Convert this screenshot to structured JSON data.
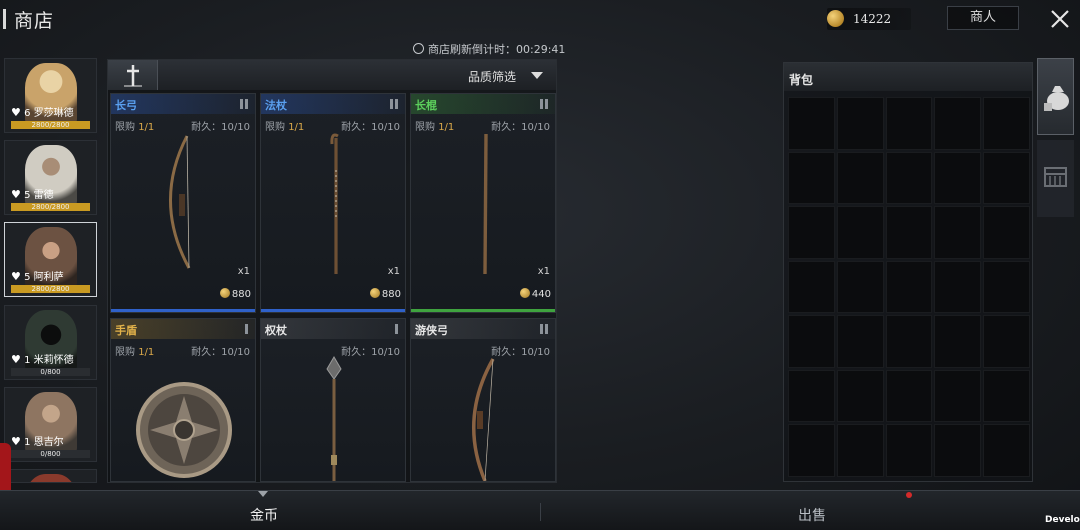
{
  "header": {
    "title": "商店",
    "gold_amount": "14222",
    "merchant_button": "商人",
    "refresh_label": "商店刷新倒计时：00:29:41"
  },
  "characters": [
    {
      "level": "6",
      "name": "罗莎琳德",
      "hp": "2800/2800",
      "hp_fraction": 1.0,
      "portrait_color": "#c9a36a"
    },
    {
      "level": "5",
      "name": "雷德",
      "hp": "2800/2800",
      "hp_fraction": 1.0,
      "portrait_color": "#b8b4a8"
    },
    {
      "level": "5",
      "name": "阿利萨",
      "hp": "2800/2800",
      "hp_fraction": 1.0,
      "portrait_color": "#7a5e4c",
      "selected": true
    },
    {
      "level": "1",
      "name": "米莉怀德",
      "hp": "0/800",
      "hp_fraction": 0.0,
      "portrait_color": "#2f3a33"
    },
    {
      "level": "1",
      "name": "恩吉尔",
      "hp": "0/800",
      "hp_fraction": 0.0,
      "portrait_color": "#8e7561"
    }
  ],
  "shop": {
    "quality_filter": "品质筛选",
    "items": [
      {
        "name": "长弓",
        "name_color": "#5aa0f0",
        "limit_label": "限购",
        "limit": "1/1",
        "durability": "耐久：10/10",
        "qty": "x1",
        "price": "880",
        "rarity_color": "#2f61c9",
        "icon": "longbow-icon"
      },
      {
        "name": "法杖",
        "name_color": "#5aa0f0",
        "limit_label": "限购",
        "limit": "1/1",
        "durability": "耐久：10/10",
        "qty": "x1",
        "price": "880",
        "rarity_color": "#2f61c9",
        "icon": "staff-icon"
      },
      {
        "name": "长棍",
        "name_color": "#5ccf5c",
        "limit_label": "限购",
        "limit": "1/1",
        "durability": "耐久：10/10",
        "qty": "x1",
        "price": "440",
        "rarity_color": "#3fa33f",
        "icon": "long-stick-icon"
      },
      {
        "name": "手盾",
        "name_color": "#e2b24a",
        "limit_label": "限购",
        "limit": "1/1",
        "durability": "耐久：10/10",
        "icon": "shield-icon"
      },
      {
        "name": "权杖",
        "name_color": "#e6e6e6",
        "durability": "耐久：10/10",
        "icon": "scepter-icon"
      },
      {
        "name": "游侠弓",
        "name_color": "#e6e6e6",
        "durability": "耐久：10/10",
        "icon": "ranger-bow-icon"
      }
    ]
  },
  "bag": {
    "title": "背包",
    "columns": 5,
    "rows": 7
  },
  "bottom": {
    "tab_gold": "金币",
    "tab_sell": "出售",
    "dev_label": "Develop"
  }
}
